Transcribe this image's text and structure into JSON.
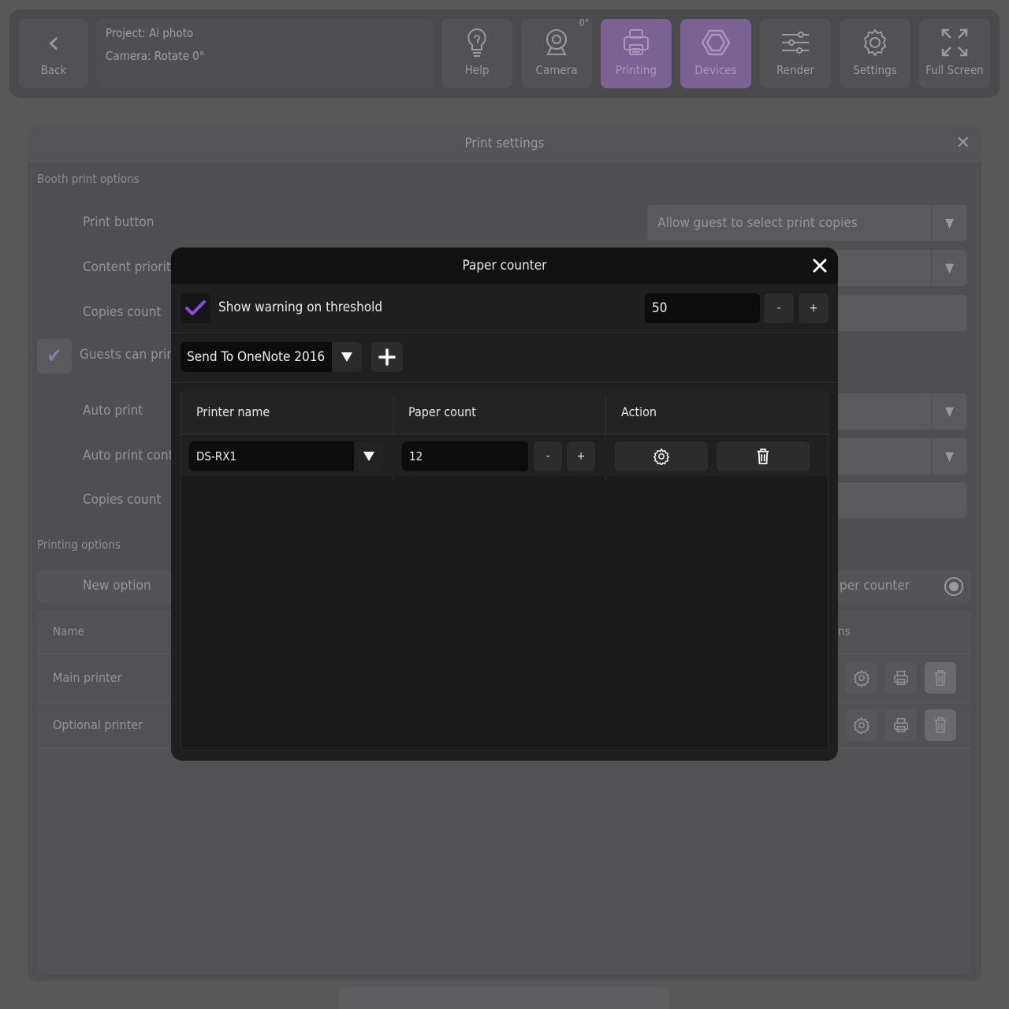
{
  "toolbar": {
    "back_label": "Back",
    "project_label": "Project: Ai photo",
    "camera_label": "Camera: Rotate 0°",
    "camera_rotation_badge": "0°",
    "buttons": [
      {
        "label": "Help",
        "icon": "bulb-icon"
      },
      {
        "label": "Camera",
        "icon": "webcam-icon"
      },
      {
        "label": "Printing",
        "icon": "printer-icon",
        "active": true
      },
      {
        "label": "Devices",
        "icon": "hexagon-icon",
        "active": true
      },
      {
        "label": "Render",
        "icon": "sliders-icon"
      },
      {
        "label": "Settings",
        "icon": "gear-icon"
      },
      {
        "label": "Full Screen",
        "icon": "expand-icon"
      }
    ]
  },
  "print_settings": {
    "title": "Print settings",
    "booth_section": "Booth print options",
    "print_button_label": "Print button",
    "print_button_value": "Allow guest to select print copies",
    "content_priority_label": "Content priorit",
    "copies_count_label": "Copies count",
    "guests_can_print_label": "Guests can prin",
    "auto_print_label": "Auto print",
    "auto_print_cont_label": "Auto print cont",
    "copies_count_label_2": "Copies count",
    "printing_section": "Printing options",
    "new_option_label": "New option",
    "paper_counter_partial": "per counter",
    "table": {
      "col_name": "Name",
      "col_actions_partial": "ns",
      "rows": [
        "Main printer",
        "Optional printer"
      ]
    }
  },
  "modal": {
    "title": "Paper counter",
    "show_warning_label": "Show warning on threshold",
    "show_warning_checked": true,
    "threshold_value": "50",
    "minus_label": "-",
    "plus_label": "+",
    "printer_dropdown_value": "Send To OneNote 2016",
    "table": {
      "headers": [
        "Printer name",
        "Paper count",
        "Action"
      ],
      "rows": [
        {
          "printer": "DS-RX1",
          "paper_count": "12"
        }
      ]
    }
  },
  "colors": {
    "accent": "#8a4de0",
    "active_tab": "#7a6394",
    "modal_bg": "#1f1f1f",
    "overlay_bg": "#595859"
  }
}
